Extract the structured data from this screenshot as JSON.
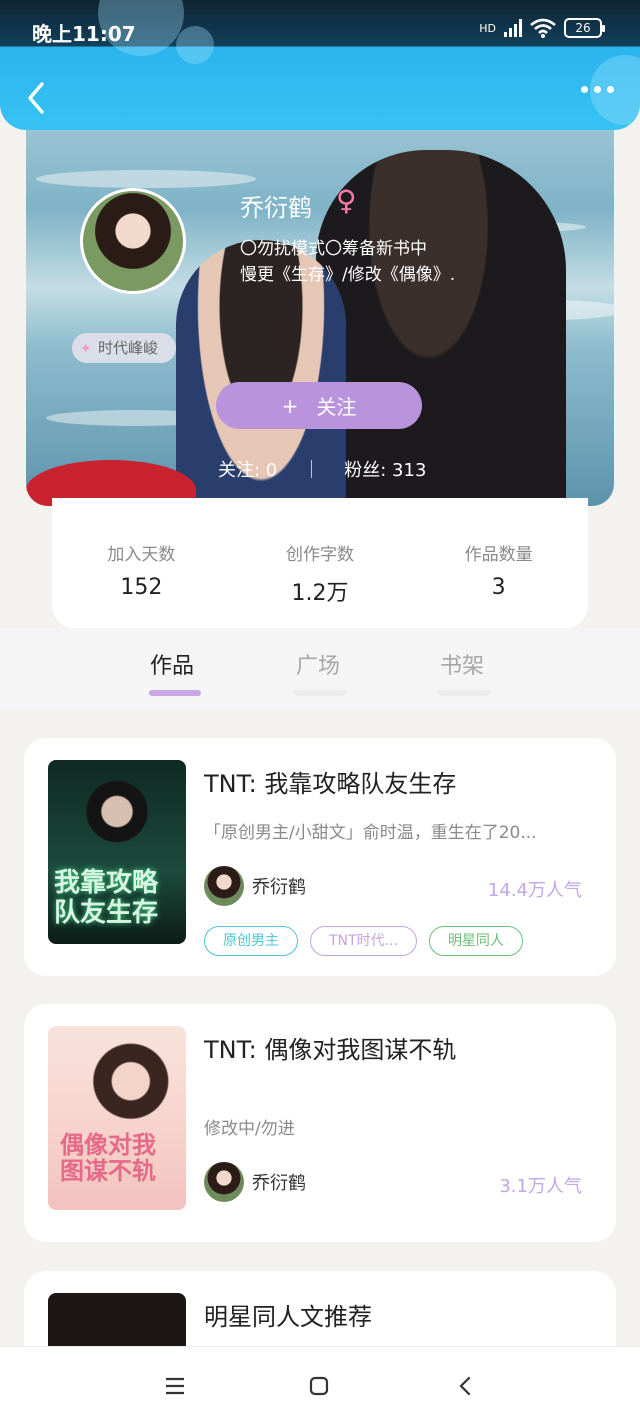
{
  "status_bar": {
    "time": "晚上11:07",
    "network": "HD",
    "battery": "26"
  },
  "header": {
    "back_icon": "chevron-left-icon",
    "more_icon": "more-dots-icon"
  },
  "profile": {
    "nickname": "乔衍鹤",
    "gender_symbol": "♀",
    "bio_line1": "〇勿扰模式〇筹备新书中",
    "bio_line2": "慢更《生存》/修改《偶像》.",
    "badge": "时代峰峻",
    "follow_button": {
      "plus": "+",
      "label": "关注"
    },
    "following": "关注: 0",
    "fans": "粉丝: 313"
  },
  "stats": [
    {
      "label": "加入天数",
      "value": "152"
    },
    {
      "label": "创作字数",
      "value": "1.2万"
    },
    {
      "label": "作品数量",
      "value": "3"
    }
  ],
  "tabs": [
    {
      "label": "作品",
      "active": true
    },
    {
      "label": "广场",
      "active": false
    },
    {
      "label": "书架",
      "active": false
    }
  ],
  "colors": {
    "accent": "#b994dc",
    "header": "#37c3f3",
    "popularity": "#c4a6e6"
  },
  "works": [
    {
      "title": "TNT: 我靠攻略队友生存",
      "description": "「原创男主/小甜文」俞时温，重生在了20...",
      "author": "乔衍鹤",
      "popularity": "14.4万人气",
      "cover_text": "我靠攻略队友生存",
      "tags": [
        {
          "label": "原创男主",
          "color": "#4cc6d8"
        },
        {
          "label": "TNT时代...",
          "color": "#c7a3e2"
        },
        {
          "label": "明星同人",
          "color": "#6bbf7a"
        }
      ]
    },
    {
      "title": "TNT: 偶像对我图谋不轨",
      "description": "修改中/勿进",
      "author": "乔衍鹤",
      "popularity": "3.1万人气",
      "cover_text": "偶像对我图谋不轨"
    },
    {
      "title": "明星同人文推荐"
    }
  ],
  "nav": {
    "menu_icon": "menu-icon",
    "home_icon": "home-square-icon",
    "back_icon": "back-triangle-icon"
  }
}
